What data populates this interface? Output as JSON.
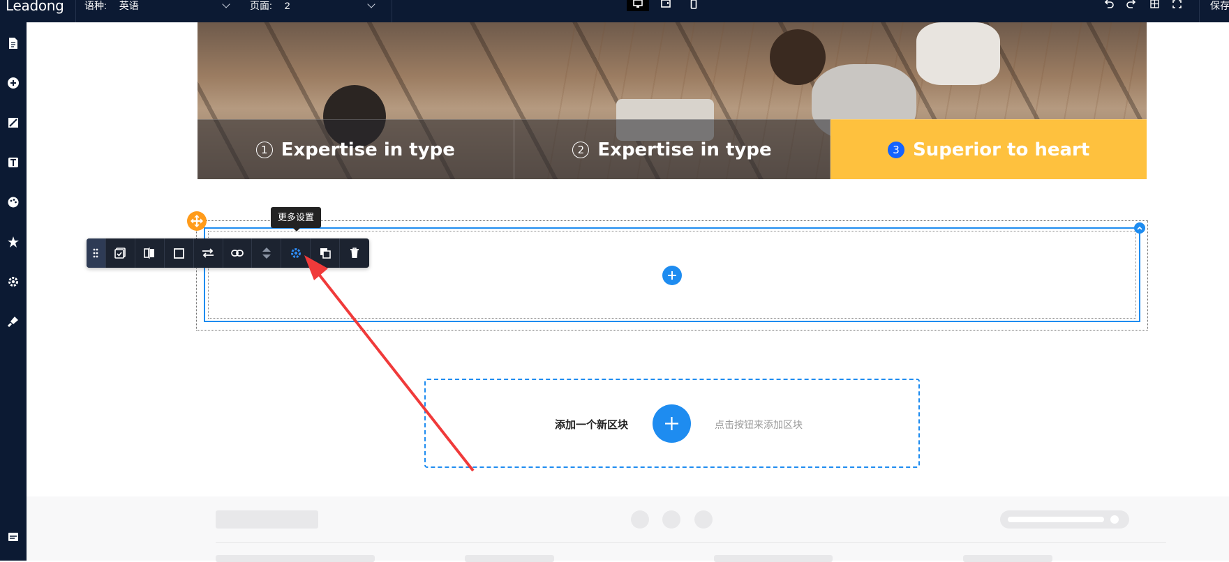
{
  "app": {
    "logo_text": "Leadong",
    "save_label": "保存"
  },
  "topbar": {
    "language_label": "语种:",
    "language_value": "英语",
    "page_label": "页面:",
    "page_value": "2",
    "device_icons": [
      "desktop-icon",
      "tablet-icon",
      "mobile-icon"
    ],
    "active_device": "desktop",
    "action_icons": [
      "undo-icon",
      "redo-icon",
      "grid-icon",
      "fullscreen-icon"
    ]
  },
  "sidebar": {
    "items": [
      "page-icon",
      "add-circle-icon",
      "edit-icon",
      "text-icon",
      "palette-icon",
      "star-icon",
      "settings-icon",
      "brush-icon",
      "layout-icon"
    ]
  },
  "hero": {
    "tabs": [
      {
        "number": "1",
        "label": "Expertise in type"
      },
      {
        "number": "2",
        "label": "Expertise in type"
      },
      {
        "number": "3",
        "label": "Superior to heart"
      }
    ],
    "active_tab_color": "#fec13e",
    "number_badge_color": "#1463ff"
  },
  "section_toolbar": {
    "tooltip": "更多设置",
    "tools": [
      "drag-handle-icon",
      "save-block-icon",
      "swap-layout-icon",
      "border-icon",
      "swap-icon",
      "link-icon",
      "move-updown-icon",
      "settings-icon",
      "copy-icon",
      "delete-icon"
    ],
    "active_tool": "settings-icon"
  },
  "new_block": {
    "title": "添加一个新区块",
    "hint": "点击按钮来添加区块"
  },
  "colors": {
    "topbar_bg": "#0c1a33",
    "accent_blue": "#1e8cf0",
    "accent_orange": "#ff9b1a",
    "arrow_red": "#f03a3a"
  }
}
